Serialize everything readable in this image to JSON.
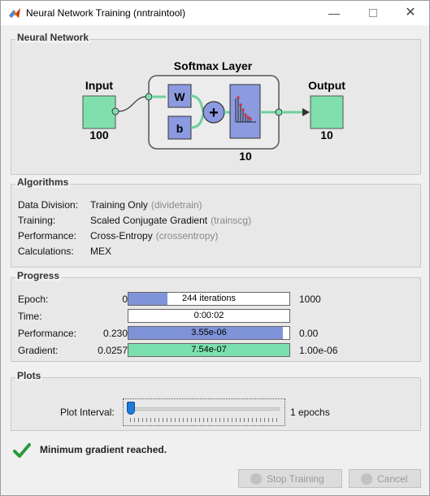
{
  "window": {
    "title": "Neural Network Training (nntraintool)"
  },
  "network": {
    "section_title": "Neural Network",
    "layer_title": "Softmax Layer",
    "input_label": "Input",
    "input_size": "100",
    "output_label": "Output",
    "output_size": "10",
    "layer_size": "10",
    "weight_label": "W",
    "bias_label": "b",
    "sum_symbol": "+"
  },
  "algorithms": {
    "section_title": "Algorithms",
    "rows": [
      {
        "label": "Data Division:",
        "value": "Training Only",
        "sub": "(dividetrain)"
      },
      {
        "label": "Training:",
        "value": "Scaled Conjugate Gradient",
        "sub": "(trainscg)"
      },
      {
        "label": "Performance:",
        "value": "Cross-Entropy",
        "sub": "(crossentropy)"
      },
      {
        "label": "Calculations:",
        "value": "MEX",
        "sub": ""
      }
    ]
  },
  "progress": {
    "section_title": "Progress",
    "rows": [
      {
        "label": "Epoch:",
        "min": "0",
        "text": "244 iterations",
        "max": "1000",
        "fill_fraction": 0.24,
        "fill_color": "#7f94d8"
      },
      {
        "label": "Time:",
        "min": "",
        "text": "0:00:02",
        "max": "",
        "fill_fraction": 0,
        "fill_color": "#7f94d8"
      },
      {
        "label": "Performance:",
        "min": "0.230",
        "text": "3.55e-06",
        "max": "0.00",
        "fill_fraction": 0.96,
        "fill_color": "#7f94d8"
      },
      {
        "label": "Gradient:",
        "min": "0.0257",
        "text": "7.54e-07",
        "max": "1.00e-06",
        "fill_fraction": 1.0,
        "fill_color": "#7be0ad"
      }
    ]
  },
  "plots": {
    "section_title": "Plots",
    "interval_label": "Plot Interval:",
    "interval_value": "1 epochs"
  },
  "status": {
    "message": "Minimum gradient reached.",
    "icon": "checkmark-icon"
  },
  "buttons": {
    "stop_label": "Stop Training",
    "cancel_label": "Cancel"
  },
  "colors": {
    "node_green": "#80e0ad",
    "node_blue": "#8c9ae0",
    "accent_blue": "#1f79d6"
  }
}
